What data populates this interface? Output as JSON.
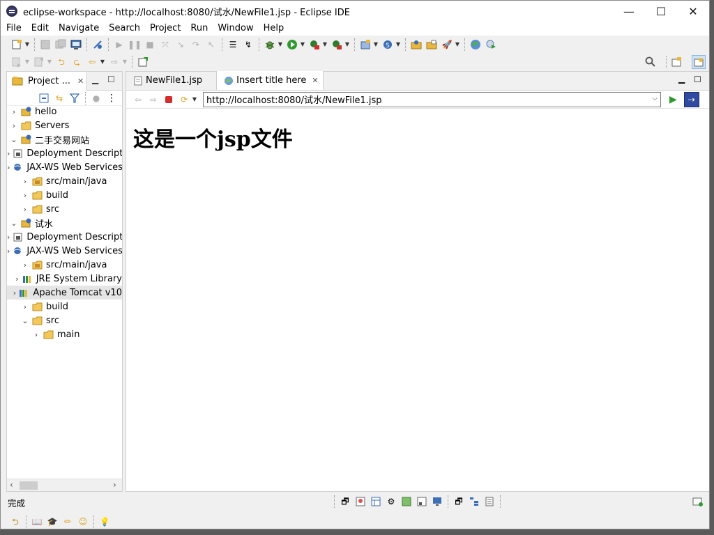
{
  "window": {
    "title": "eclipse-workspace - http://localhost:8080/试水/NewFile1.jsp - Eclipse IDE",
    "minimize_glyph": "—",
    "maximize_glyph": "☐",
    "close_glyph": "✕"
  },
  "menu": [
    "File",
    "Edit",
    "Navigate",
    "Search",
    "Project",
    "Run",
    "Window",
    "Help"
  ],
  "project_explorer": {
    "tab_label": "Project ...",
    "tree": [
      {
        "label": "hello",
        "level": 0,
        "expanded": false,
        "icon": "project-icon"
      },
      {
        "label": "Servers",
        "level": 0,
        "expanded": false,
        "icon": "folder-icon"
      },
      {
        "label": "二手交易网站",
        "level": 0,
        "expanded": true,
        "icon": "project-icon"
      },
      {
        "label": "Deployment Descriptor",
        "level": 1,
        "expanded": false,
        "icon": "deployment-icon"
      },
      {
        "label": "JAX-WS Web Services",
        "level": 1,
        "expanded": false,
        "icon": "webservice-icon"
      },
      {
        "label": "src/main/java",
        "level": 1,
        "expanded": false,
        "icon": "source-folder-icon"
      },
      {
        "label": "build",
        "level": 1,
        "expanded": false,
        "icon": "folder-icon"
      },
      {
        "label": "src",
        "level": 1,
        "expanded": false,
        "icon": "folder-icon"
      },
      {
        "label": "试水",
        "level": 0,
        "expanded": true,
        "icon": "project-icon"
      },
      {
        "label": "Deployment Descriptor",
        "level": 1,
        "expanded": false,
        "icon": "deployment-icon"
      },
      {
        "label": "JAX-WS Web Services",
        "level": 1,
        "expanded": false,
        "icon": "webservice-icon"
      },
      {
        "label": "src/main/java",
        "level": 1,
        "expanded": false,
        "icon": "source-folder-icon"
      },
      {
        "label": "JRE System Library",
        "level": 1,
        "expanded": false,
        "icon": "library-icon"
      },
      {
        "label": "Apache Tomcat v10",
        "level": 1,
        "expanded": false,
        "icon": "library-icon",
        "selected": true
      },
      {
        "label": "build",
        "level": 1,
        "expanded": false,
        "icon": "folder-icon"
      },
      {
        "label": "src",
        "level": 1,
        "expanded": true,
        "icon": "folder-icon"
      },
      {
        "label": "main",
        "level": 2,
        "expanded": false,
        "icon": "folder-icon"
      }
    ]
  },
  "editor": {
    "tabs": [
      {
        "label": "NewFile1.jsp",
        "active": false
      },
      {
        "label": "Insert title here",
        "active": true
      }
    ],
    "url": "http://localhost:8080/试水/NewFile1.jsp",
    "page_heading": "这是一个jsp文件"
  },
  "status": {
    "text": "完成"
  },
  "colors": {
    "run_green": "#2e9a2e",
    "stop_red": "#d62c2c",
    "folder_yellow": "#e9b73b",
    "selection_gray": "#e5e5e5"
  }
}
